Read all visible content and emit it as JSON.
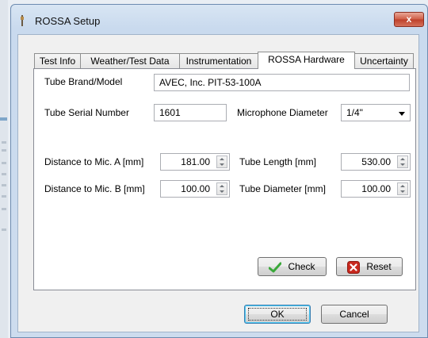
{
  "window": {
    "title": "ROSSA Setup",
    "close_label": "x"
  },
  "tabs": [
    {
      "label": "Test Info",
      "active": false
    },
    {
      "label": "Weather/Test Data",
      "active": false
    },
    {
      "label": "Instrumentation",
      "active": false
    },
    {
      "label": "ROSSA Hardware",
      "active": true
    },
    {
      "label": "Uncertainty",
      "active": false
    }
  ],
  "form": {
    "tube_brand_label": "Tube Brand/Model",
    "tube_brand_value": "AVEC, Inc. PIT-53-100A",
    "tube_serial_label": "Tube Serial Number",
    "tube_serial_value": "1601",
    "mic_diameter_label": "Microphone Diameter",
    "mic_diameter_value": "1/4\"",
    "dist_a_label": "Distance to Mic. A [mm]",
    "dist_a_value": "181.00",
    "dist_b_label": "Distance to Mic. B [mm]",
    "dist_b_value": "100.00",
    "tube_length_label": "Tube Length [mm]",
    "tube_length_value": "530.00",
    "tube_diameter_label": "Tube Diameter [mm]",
    "tube_diameter_value": "100.00"
  },
  "buttons": {
    "check": "Check",
    "reset": "Reset",
    "ok": "OK",
    "cancel": "Cancel"
  },
  "icons": {
    "check": "checkmark-icon",
    "reset": "red-x-icon",
    "app": "app-icon",
    "close": "close-icon"
  },
  "colors": {
    "check_green": "#3aa83a",
    "reset_red": "#c8281e",
    "close_red": "#c9483a"
  }
}
